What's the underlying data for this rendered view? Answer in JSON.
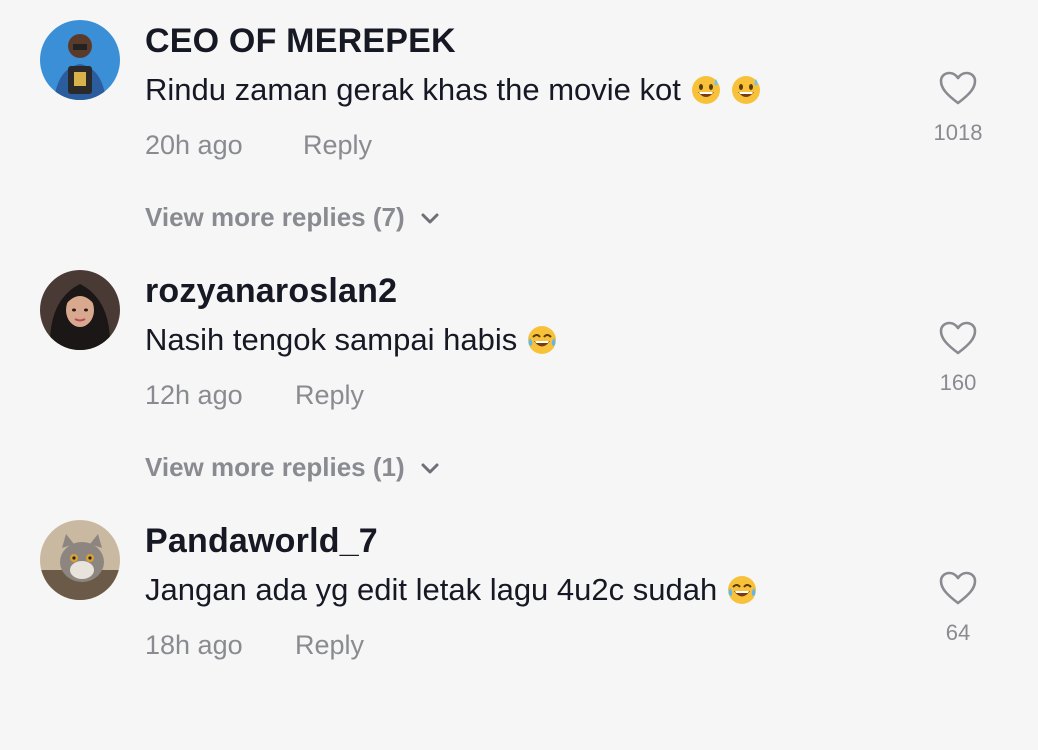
{
  "comments": [
    {
      "username": "CEO OF MEREPEK",
      "text": "Rindu zaman gerak khas the movie kot",
      "emojis": [
        "grinning-sweat-emoji",
        "grinning-sweat-emoji"
      ],
      "time": "20h ago",
      "reply_label": "Reply",
      "likes": "1018",
      "more_replies": "View more replies (7)"
    },
    {
      "username": "rozyanaroslan2",
      "text": "Nasih tengok sampai habis",
      "emojis": [
        "tears-of-joy-emoji"
      ],
      "time": "12h ago",
      "reply_label": "Reply",
      "likes": "160",
      "more_replies": "View more replies (1)"
    },
    {
      "username": "Pandaworld_7",
      "text": "Jangan ada yg edit letak lagu 4u2c sudah",
      "emojis": [
        "tears-of-joy-emoji"
      ],
      "time": "18h ago",
      "reply_label": "Reply",
      "likes": "64"
    }
  ],
  "icons": {
    "like": "heart-outline-icon",
    "expand": "chevron-down-icon"
  },
  "colors": {
    "background": "#f6f6f6",
    "primary_text": "#161823",
    "secondary_text": "#8a8b91"
  }
}
